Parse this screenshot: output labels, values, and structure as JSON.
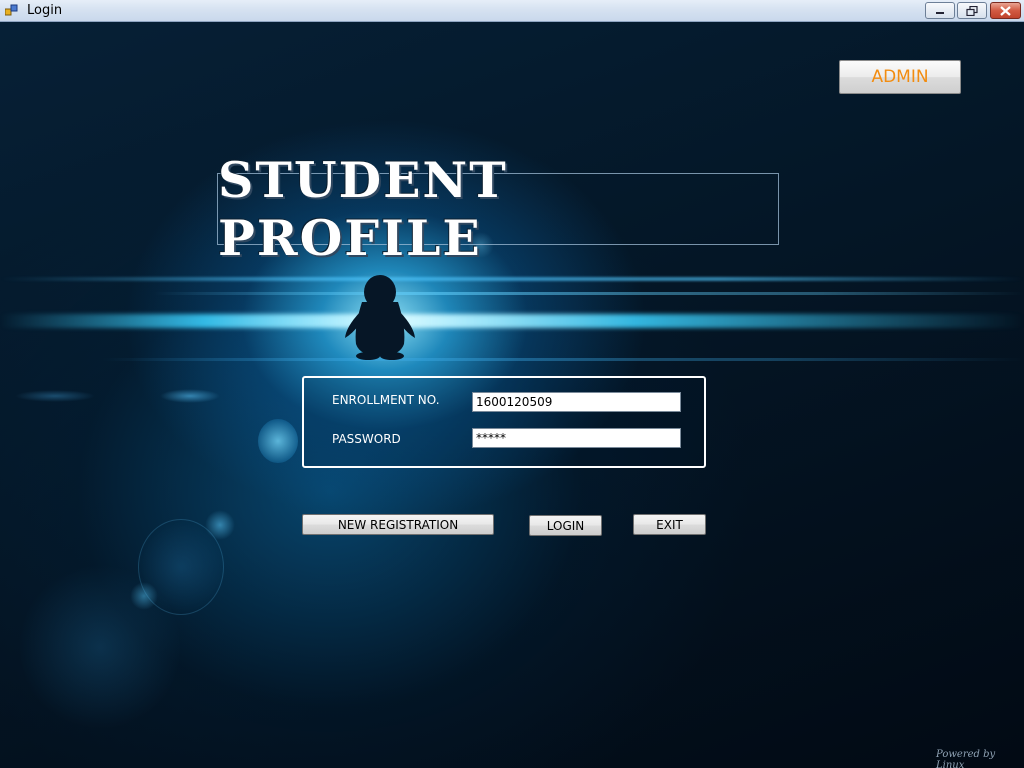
{
  "window": {
    "title": "Login",
    "buttons": [
      "minimize",
      "restore",
      "close"
    ]
  },
  "admin_button": {
    "label": "ADMIN",
    "color": "#f28c10"
  },
  "banner": {
    "title": "STUDENT PROFILE"
  },
  "login_form": {
    "enrollment_label": "ENROLLMENT NO.",
    "enrollment_value": "1600120509",
    "password_label": "PASSWORD",
    "password_value": "*****"
  },
  "actions": {
    "new_registration": "NEW REGISTRATION",
    "login": "LOGIN",
    "exit": "EXIT"
  },
  "footer": {
    "powered_by": "Powered by Linux"
  },
  "icons": {
    "app": "app-icon",
    "mascot": "penguin-icon"
  }
}
